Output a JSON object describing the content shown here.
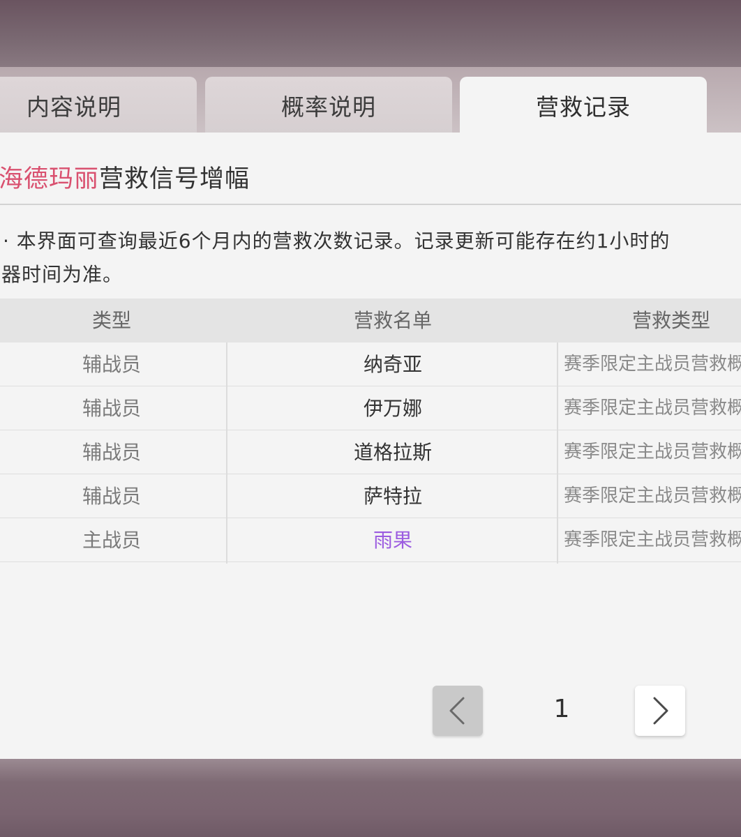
{
  "tabs": [
    {
      "label": "内容说明",
      "active": false
    },
    {
      "label": "概率说明",
      "active": false
    },
    {
      "label": "营救记录",
      "active": true
    }
  ],
  "title": {
    "highlight": "海德玛丽",
    "rest": "营救信号增幅"
  },
  "notice": {
    "line1": "· 本界面可查询最近6个月内的营救次数记录。记录更新可能存在约1小时的",
    "line2": "器时间为准。"
  },
  "table": {
    "headers": [
      "类型",
      "营救名单",
      "营救类型"
    ],
    "rows": [
      {
        "type": "辅战员",
        "name": "纳奇亚",
        "rescue_type": "赛季限定主战员营救概率"
      },
      {
        "type": "辅战员",
        "name": "伊万娜",
        "rescue_type": "赛季限定主战员营救概率"
      },
      {
        "type": "辅战员",
        "name": "道格拉斯",
        "rescue_type": "赛季限定主战员营救概率"
      },
      {
        "type": "辅战员",
        "name": "萨特拉",
        "rescue_type": "赛季限定主战员营救概率"
      },
      {
        "type": "主战员",
        "name": "雨果",
        "rescue_type": "赛季限定主战员营救概率"
      }
    ]
  },
  "pagination": {
    "current_page": "1",
    "prev_icon": "chevron-left-icon",
    "next_icon": "chevron-right-icon"
  },
  "colors": {
    "accent_pink": "#d9506f",
    "highlight_purple": "#9b5be0",
    "panel_bg": "#f4f4f4"
  }
}
